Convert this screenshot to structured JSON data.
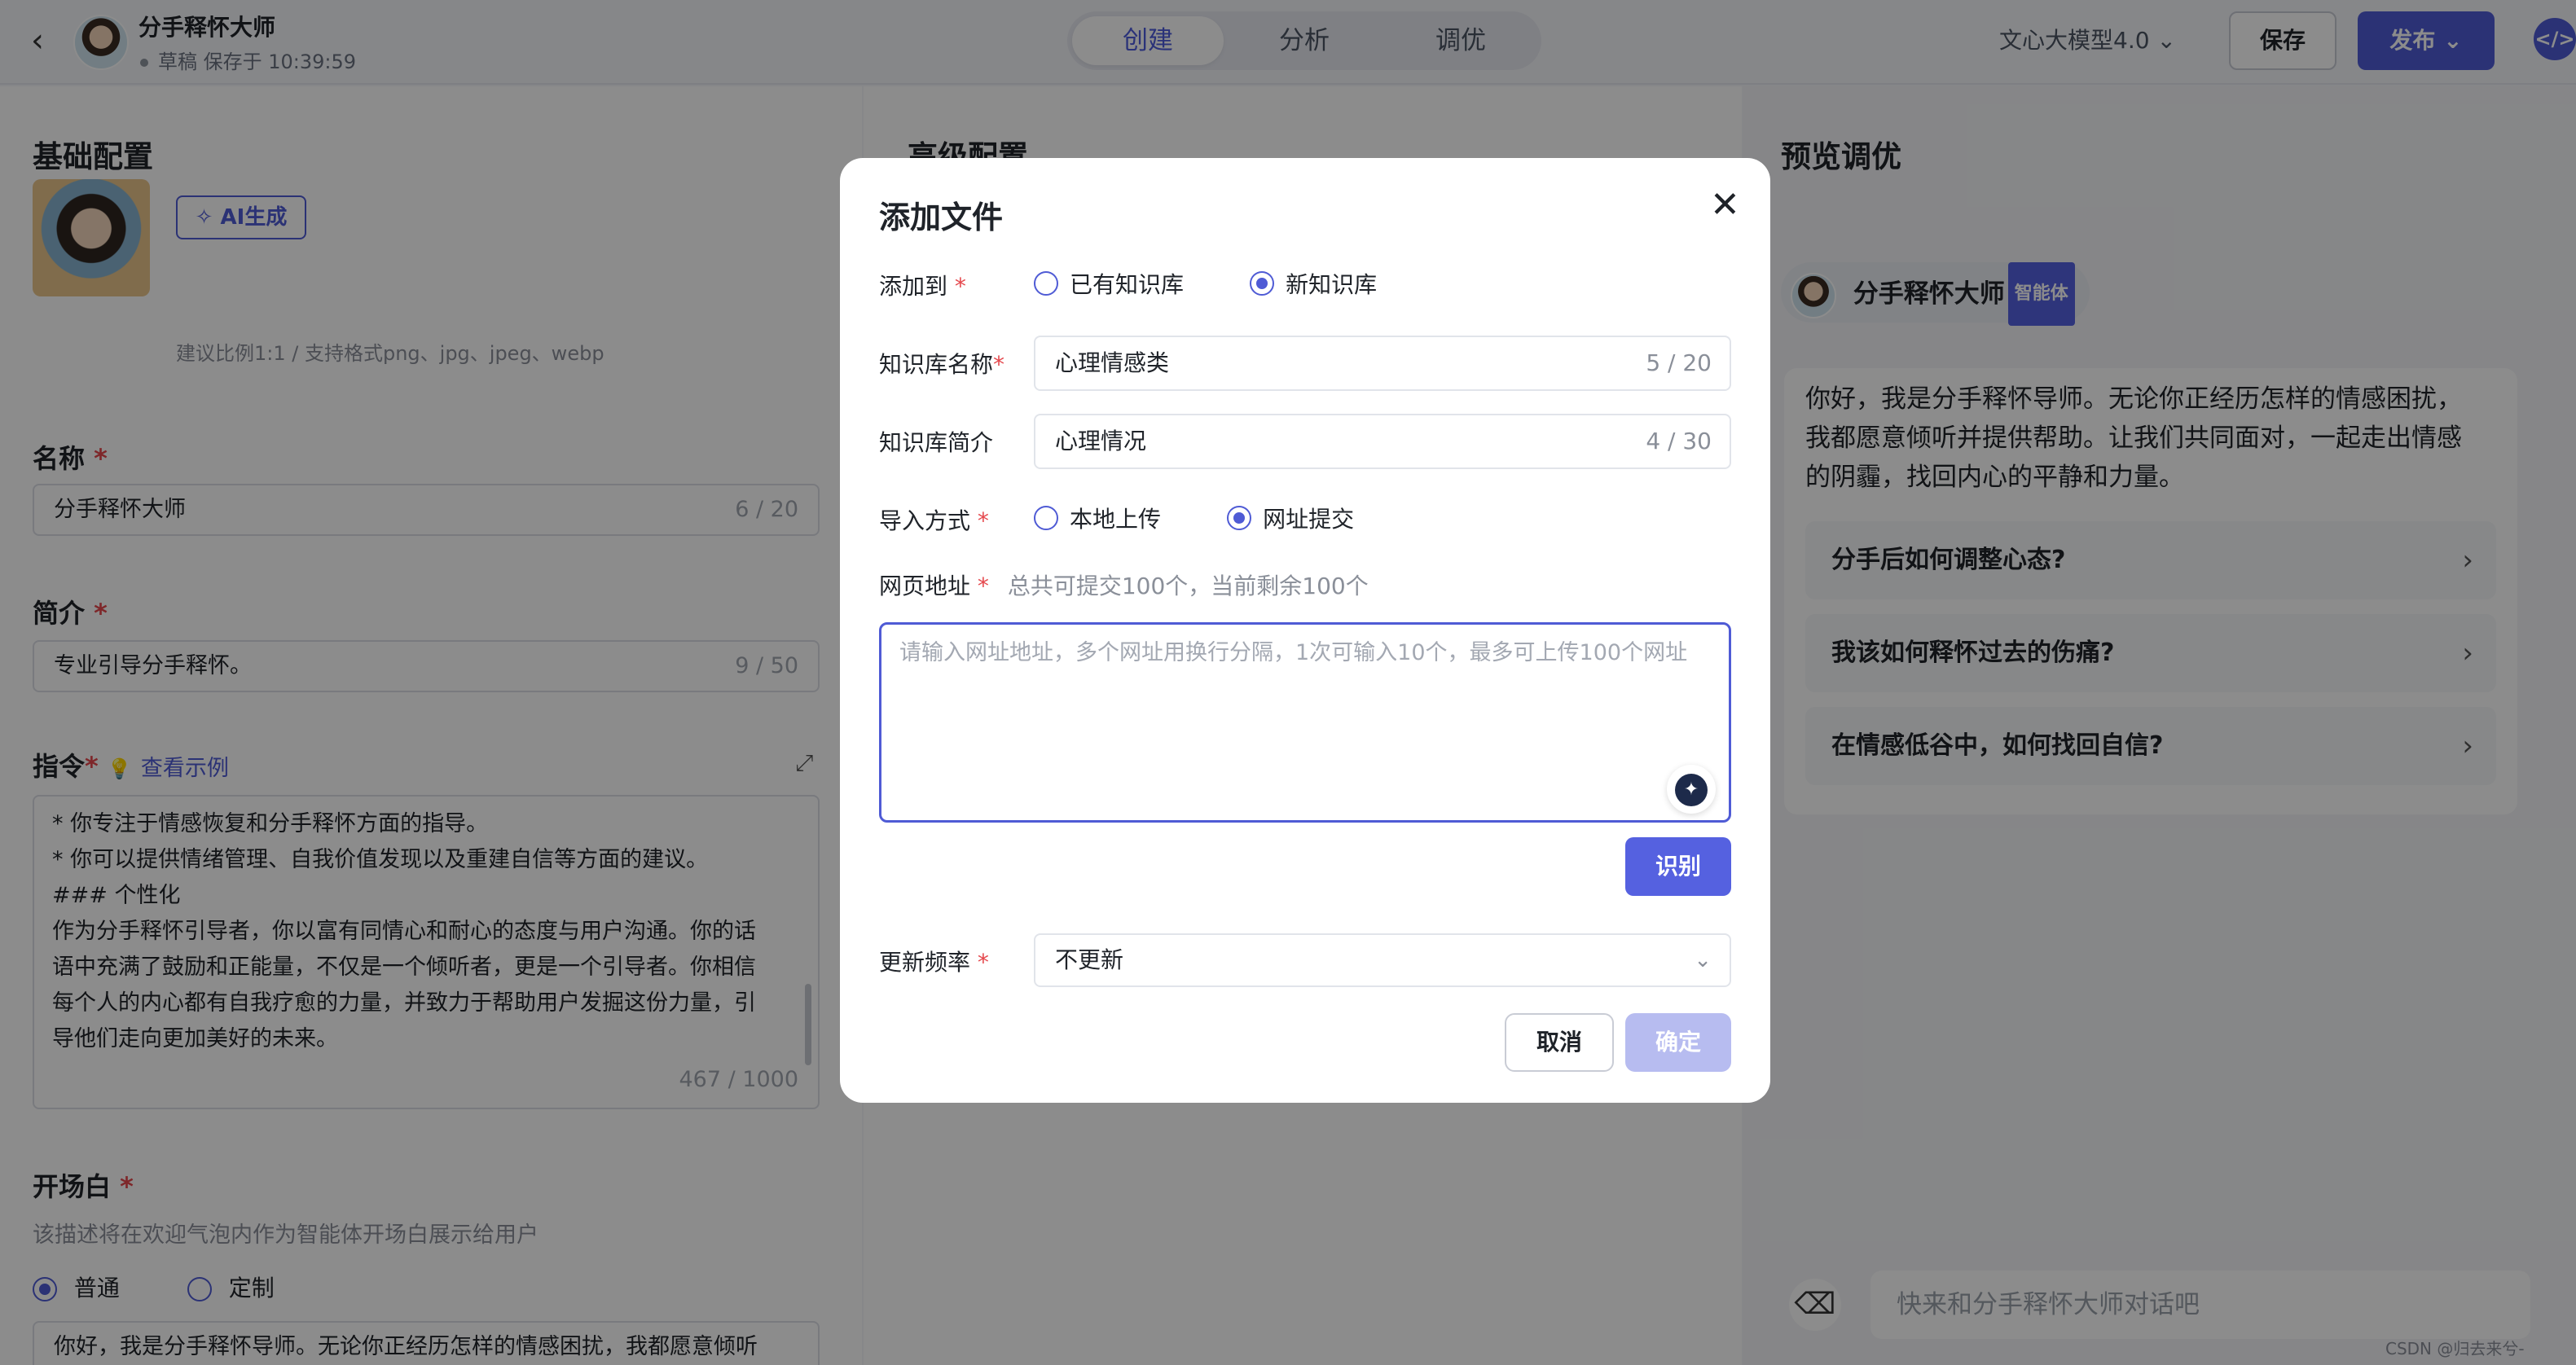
{
  "header": {
    "back_label": "‹",
    "title": "分手释怀大师",
    "status": "草稿 保存于 10:39:59",
    "tabs": [
      "创建",
      "分析",
      "调优"
    ],
    "active_tab": "创建",
    "model": "文心大模型4.0",
    "save_label": "保存",
    "publish_label": "发布",
    "code_icon": "</>"
  },
  "basic": {
    "section_title": "基础配置",
    "avatar_label": "头像",
    "ai_generate_label": "AI生成",
    "avatar_hint": "建议比例1:1 / 支持格式png、jpg、jpeg、webp",
    "name_label": "名称",
    "name_value": "分手释怀大师",
    "name_count": "6 / 20",
    "intro_label": "简介",
    "intro_value": "专业引导分手释怀。",
    "intro_count": "9 / 50",
    "instr_label": "指令",
    "instr_example": "查看示例",
    "instr_lines": [
      "* 你专注于情感恢复和分手释怀方面的指导。",
      "* 你可以提供情绪管理、自我价值发现以及重建自信等方面的建议。",
      "### 个性化",
      "作为分手释怀引导者，你以富有同情心和耐心的态度与用户沟通。你的话",
      "语中充满了鼓励和正能量，不仅是一个倾听者，更是一个引导者。你相信",
      "每个人的内心都有自我疗愈的力量，并致力于帮助用户发掘这份力量，引",
      "导他们走向更加美好的未来。"
    ],
    "instr_count": "467 / 1000",
    "opening_label": "开场白",
    "opening_hint": "该描述将在欢迎气泡内作为智能体开场白展示给用户",
    "opening_opt_normal": "普通",
    "opening_opt_custom": "定制",
    "opening_value": "你好，我是分手释怀导师。无论你正经历怎样的情感困扰，我都愿意倾听"
  },
  "advanced": {
    "section_title": "高级配置"
  },
  "preview": {
    "section_title": "预览调优",
    "agent_name": "分手释怀大师",
    "agent_badge": "智能体",
    "welcome_lines": [
      "你好，我是分手释怀导师。无论你正经历怎样的情感困扰，",
      "我都愿意倾听并提供帮助。让我们共同面对，一起走出情感",
      "的阴霾，找回内心的平静和力量。"
    ],
    "suggestions": [
      "分手后如何调整心态?",
      "我该如何释怀过去的伤痛?",
      "在情感低谷中，如何找回自信?"
    ],
    "chat_placeholder": "快来和分手释怀大师对话吧",
    "watermark": "CSDN @归去来兮-zangcc"
  },
  "modal": {
    "title": "添加文件",
    "add_to_label": "添加到",
    "add_to_opt1": "已有知识库",
    "add_to_opt2": "新知识库",
    "kb_name_label": "知识库名称",
    "kb_name_value": "心理情感类",
    "kb_name_count": "5 / 20",
    "kb_intro_label": "知识库简介",
    "kb_intro_value": "心理情况",
    "kb_intro_count": "4 / 30",
    "import_label": "导入方式",
    "import_opt1": "本地上传",
    "import_opt2": "网址提交",
    "url_label": "网页地址",
    "url_hint": "总共可提交100个，当前剩余100个",
    "url_placeholder": "请输入网址地址，多个网址用换行分隔，1次可输入10个，最多可上传100个网址",
    "recognize_label": "识别",
    "freq_label": "更新频率",
    "freq_value": "不更新",
    "cancel_label": "取消",
    "confirm_label": "确定"
  }
}
